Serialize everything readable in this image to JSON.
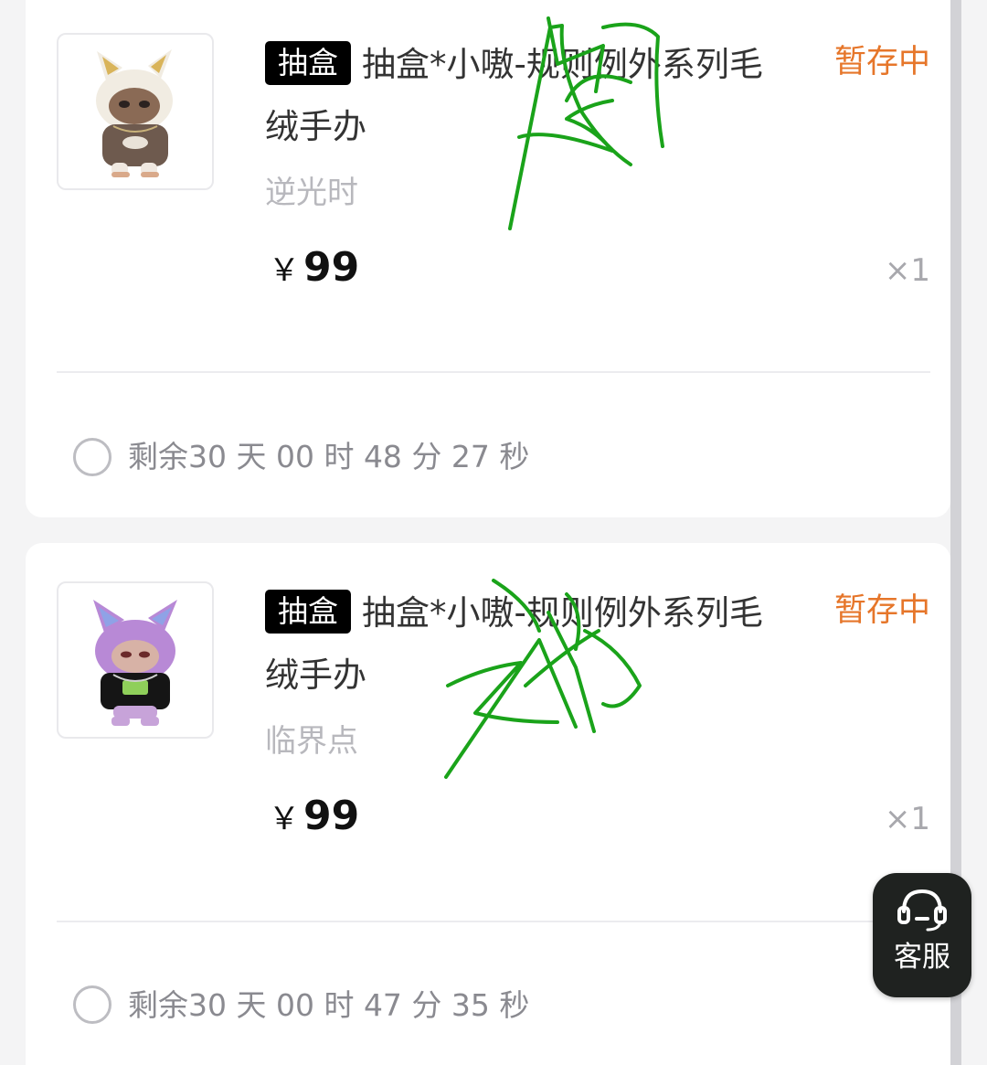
{
  "orders": [
    {
      "tag": "抽盒",
      "title": "抽盒*小嗷-规则例外系列毛绒手办",
      "status": "暂存中",
      "variant": "逆光时",
      "currency": "￥",
      "price": "99",
      "quantity": "×1",
      "countdown": "剩余30 天 00 时 48 分 27 秒",
      "figure_colors": {
        "fur": "#f1ece2",
        "ear_inner": "#d9b45a",
        "shirt": "#6e5a4e",
        "skin": "#8a6a55",
        "shoes": "#f0e8e0"
      }
    },
    {
      "tag": "抽盒",
      "title": "抽盒*小嗷-规则例外系列毛绒手办",
      "status": "暂存中",
      "variant": "临界点",
      "currency": "￥",
      "price": "99",
      "quantity": "×1",
      "countdown": "剩余30 天 00 时 47 分 35 秒",
      "figure_colors": {
        "fur": "#b889d6",
        "ear_inner": "#8fa2e6",
        "shirt": "#151515",
        "skin": "#d7b2a6",
        "shoes": "#c7a3d9"
      }
    }
  ],
  "service_button": {
    "label": "客服",
    "icon": "headset-icon"
  },
  "colors": {
    "accent": "#e6762a",
    "tag_bg": "#000000",
    "scribble": "#1aa31a"
  }
}
